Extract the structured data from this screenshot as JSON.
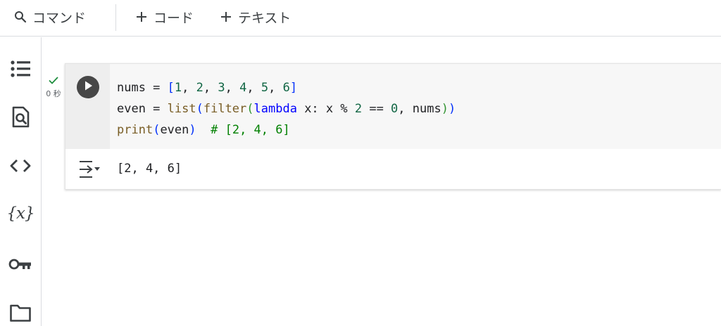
{
  "toolbar": {
    "command_label": "コマンド",
    "add_code_label": "コード",
    "add_text_label": "テキスト"
  },
  "sidebar": {
    "items": [
      {
        "icon": "table-of-contents-icon"
      },
      {
        "icon": "find-replace-icon"
      },
      {
        "icon": "code-snippets-icon"
      },
      {
        "icon": "variables-icon",
        "glyph": "{x}"
      },
      {
        "icon": "secrets-key-icon"
      },
      {
        "icon": "files-folder-icon"
      }
    ]
  },
  "cell": {
    "status_icon": "check-icon",
    "execution_time": "0 秒",
    "code_lines": [
      "nums = [1, 2, 3, 4, 5, 6]",
      "even = list(filter(lambda x: x % 2 == 0, nums))",
      "print(even)  # [2, 4, 6]"
    ],
    "output": "[2, 4, 6]"
  },
  "colors": {
    "run_button": "#474747",
    "check": "#1e8e3e",
    "keyword": "#0000ff",
    "number": "#116644",
    "function": "#795e26",
    "comment": "#008000"
  }
}
